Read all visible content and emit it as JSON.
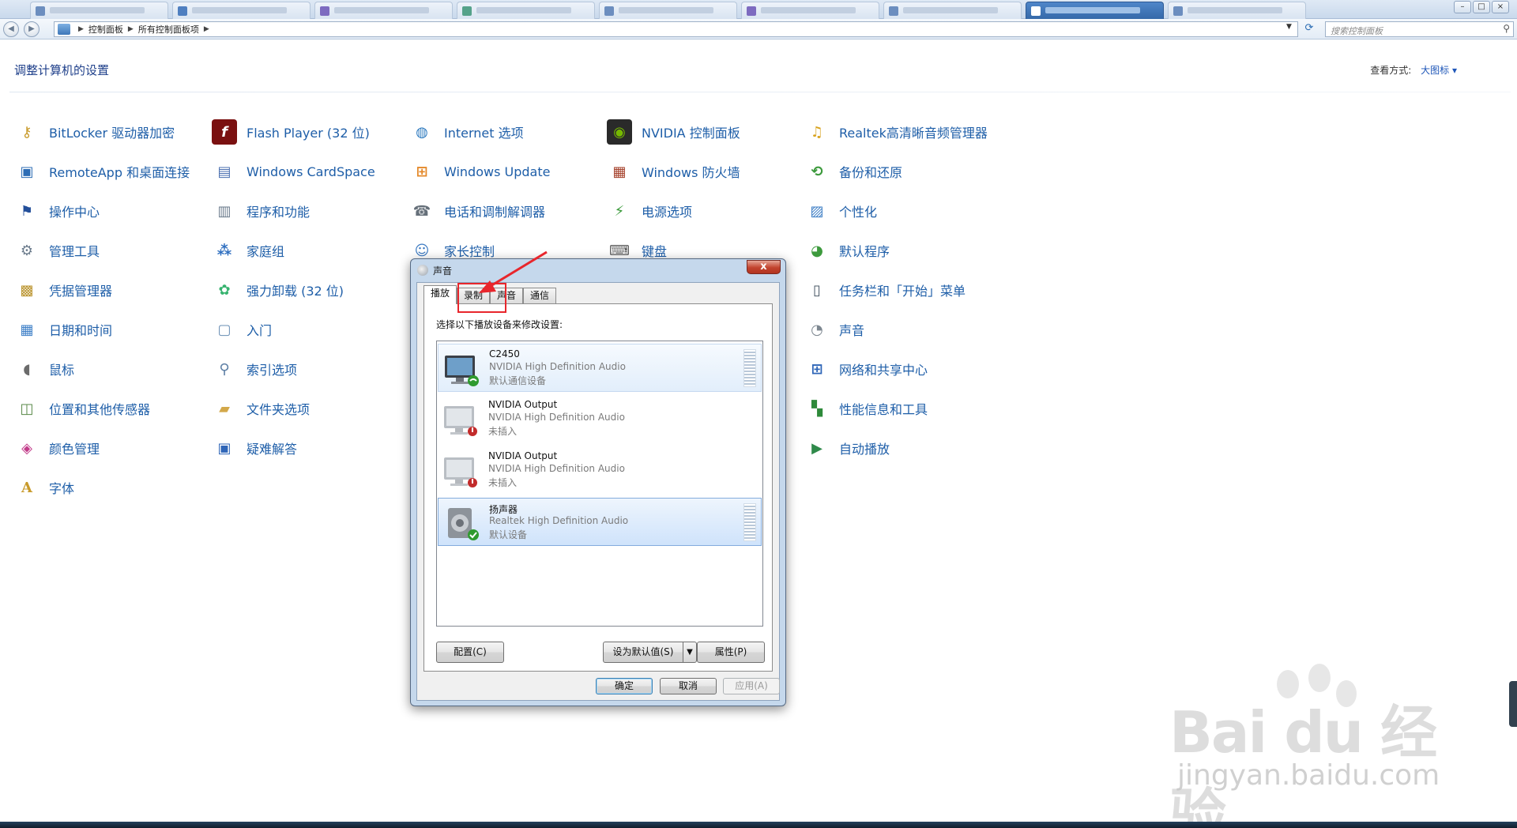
{
  "address_bar": {
    "path": [
      "控制面板",
      "所有控制面板项"
    ],
    "search_placeholder": "搜索控制面板"
  },
  "header": {
    "title": "调整计算机的设置",
    "view_label": "查看方式:",
    "view_value": "大图标"
  },
  "items": [
    {
      "label": "BitLocker 驱动器加密",
      "icon": "bitlocker-key-icon"
    },
    {
      "label": "Flash Player (32 位)",
      "icon": "flash-player-icon"
    },
    {
      "label": "Internet 选项",
      "icon": "internet-options-icon"
    },
    {
      "label": "NVIDIA 控制面板",
      "icon": "nvidia-icon"
    },
    {
      "label": "Realtek高清晰音频管理器",
      "icon": "realtek-audio-icon"
    },
    {
      "label": "RemoteApp 和桌面连接",
      "icon": "remoteapp-icon"
    },
    {
      "label": "Windows CardSpace",
      "icon": "cardspace-icon"
    },
    {
      "label": "Windows Update",
      "icon": "windows-update-icon"
    },
    {
      "label": "Windows 防火墙",
      "icon": "firewall-icon"
    },
    {
      "label": "备份和还原",
      "icon": "backup-restore-icon"
    },
    {
      "label": "操作中心",
      "icon": "action-center-flag-icon"
    },
    {
      "label": "程序和功能",
      "icon": "programs-features-icon"
    },
    {
      "label": "电话和调制解调器",
      "icon": "phone-modem-icon"
    },
    {
      "label": "电源选项",
      "icon": "power-options-icon"
    },
    {
      "label": "个性化",
      "icon": "personalization-icon"
    },
    {
      "label": "管理工具",
      "icon": "admin-tools-icon"
    },
    {
      "label": "家庭组",
      "icon": "homegroup-icon"
    },
    {
      "label": "家长控制",
      "icon": "parental-controls-icon"
    },
    {
      "label": "键盘",
      "icon": "keyboard-icon"
    },
    {
      "label": "默认程序",
      "icon": "default-programs-icon"
    },
    {
      "label": "凭据管理器",
      "icon": "credential-manager-icon"
    },
    {
      "label": "强力卸载 (32 位)",
      "icon": "uninstaller-icon"
    },
    {
      "label": "任务栏和「开始」菜单",
      "icon": "taskbar-start-menu-icon"
    },
    {
      "label": "日期和时间",
      "icon": "date-time-icon"
    },
    {
      "label": "入门",
      "icon": "getting-started-icon"
    },
    {
      "label": "声音",
      "icon": "sound-speaker-icon"
    },
    {
      "label": "鼠标",
      "icon": "mouse-icon"
    },
    {
      "label": "索引选项",
      "icon": "indexing-options-icon"
    },
    {
      "label": "网络和共享中心",
      "icon": "network-sharing-icon"
    },
    {
      "label": "位置和其他传感器",
      "icon": "location-sensors-icon"
    },
    {
      "label": "文件夹选项",
      "icon": "folder-options-icon"
    },
    {
      "label": "性能信息和工具",
      "icon": "performance-icon"
    },
    {
      "label": "颜色管理",
      "icon": "color-management-icon"
    },
    {
      "label": "疑难解答",
      "icon": "troubleshooting-icon"
    },
    {
      "label": "自动播放",
      "icon": "autoplay-icon"
    },
    {
      "label": "字体",
      "icon": "fonts-icon"
    }
  ],
  "dialog": {
    "title": "声音",
    "close_label": "x",
    "tabs": [
      "播放",
      "录制",
      "声音",
      "通信"
    ],
    "active_tab": "播放",
    "instruction": "选择以下播放设备来修改设置:",
    "devices": [
      {
        "name": "C2450",
        "driver": "NVIDIA High Definition Audio",
        "status": "默认通信设备"
      },
      {
        "name": "NVIDIA Output",
        "driver": "NVIDIA High Definition Audio",
        "status": "未插入"
      },
      {
        "name": "NVIDIA Output",
        "driver": "NVIDIA High Definition Audio",
        "status": "未插入"
      },
      {
        "name": "扬声器",
        "driver": "Realtek High Definition Audio",
        "status": "默认设备"
      }
    ],
    "buttons": {
      "configure": "配置(C)",
      "set_default": "设为默认值(S)",
      "properties": "属性(P)",
      "ok": "确定",
      "cancel": "取消",
      "apply": "应用(A)"
    }
  },
  "watermark": {
    "logo": "Bai du 经验",
    "url": "jingyan.baidu.com"
  },
  "colors": {
    "link_blue": "#1e5ea8",
    "title_blue": "#1e3f8a",
    "annotation_red": "#e8262c",
    "selection_blue": "#cfe3fb"
  }
}
